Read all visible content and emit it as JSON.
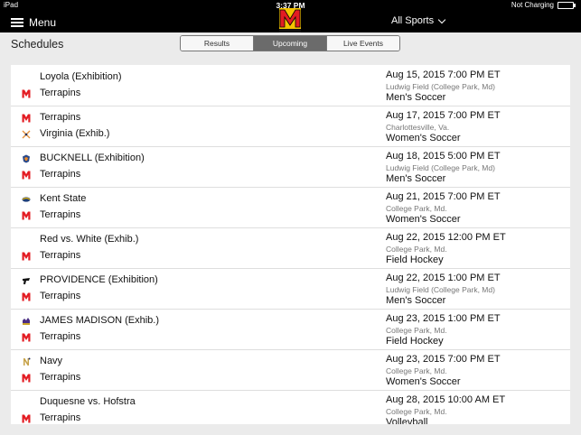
{
  "status": {
    "device": "iPad",
    "time": "3:37 PM",
    "battery": "Not Charging"
  },
  "nav": {
    "menu_label": "Menu",
    "sport_filter": "All Sports"
  },
  "header": {
    "title": "Schedules"
  },
  "tabs": [
    {
      "label": "Results",
      "active": false
    },
    {
      "label": "Upcoming",
      "active": true
    },
    {
      "label": "Live Events",
      "active": false
    }
  ],
  "colors": {
    "brand_red": "#e31c23",
    "active_tab": "#6b6b6b"
  },
  "games": [
    {
      "team1": "Loyola (Exhibition)",
      "icon1": "blank",
      "team2": "Terrapins",
      "icon2": "maryland-m-icon",
      "date": "Aug 15, 2015 7:00 PM ET",
      "location": "Ludwig Field  (College Park, Md)",
      "sport": "Men's Soccer"
    },
    {
      "team1": "Terrapins",
      "icon1": "maryland-m-icon",
      "team2": "Virginia (Exhib.)",
      "icon2": "virginia-icon",
      "date": "Aug 17, 2015 7:00 PM ET",
      "location": "Charlottesville, Va.",
      "sport": "Women's Soccer"
    },
    {
      "team1": "BUCKNELL (Exhibition)",
      "icon1": "bucknell-icon",
      "team2": "Terrapins",
      "icon2": "maryland-m-icon",
      "date": "Aug 18, 2015 5:00 PM ET",
      "location": "Ludwig Field  (College Park, Md)",
      "sport": "Men's Soccer"
    },
    {
      "team1": "Kent State",
      "icon1": "kent-state-icon",
      "team2": "Terrapins",
      "icon2": "maryland-m-icon",
      "date": "Aug 21, 2015 7:00 PM ET",
      "location": "College Park, Md.",
      "sport": "Women's Soccer"
    },
    {
      "team1": "Red vs. White (Exhib.)",
      "icon1": "blank",
      "team2": "Terrapins",
      "icon2": "maryland-m-icon",
      "date": "Aug 22, 2015 12:00 PM ET",
      "location": "College Park, Md.",
      "sport": "Field Hockey"
    },
    {
      "team1": "PROVIDENCE (Exhibition)",
      "icon1": "providence-icon",
      "team2": "Terrapins",
      "icon2": "maryland-m-icon",
      "date": "Aug 22, 2015 1:00 PM ET",
      "location": "Ludwig Field  (College Park, Md)",
      "sport": "Men's Soccer"
    },
    {
      "team1": "JAMES MADISON (Exhib.)",
      "icon1": "james-madison-icon",
      "team2": "Terrapins",
      "icon2": "maryland-m-icon",
      "date": "Aug 23, 2015 1:00 PM ET",
      "location": "College Park, Md.",
      "sport": "Field Hockey"
    },
    {
      "team1": "Navy",
      "icon1": "navy-icon",
      "team2": "Terrapins",
      "icon2": "maryland-m-icon",
      "date": "Aug 23, 2015 7:00 PM ET",
      "location": "College Park, Md.",
      "sport": "Women's Soccer"
    },
    {
      "team1": "Duquesne vs. Hofstra",
      "icon1": "blank",
      "team2": "Terrapins",
      "icon2": "maryland-m-icon",
      "date": "Aug 28, 2015 10:00 AM ET",
      "location": "College Park, Md.",
      "sport": "Volleyball"
    }
  ]
}
